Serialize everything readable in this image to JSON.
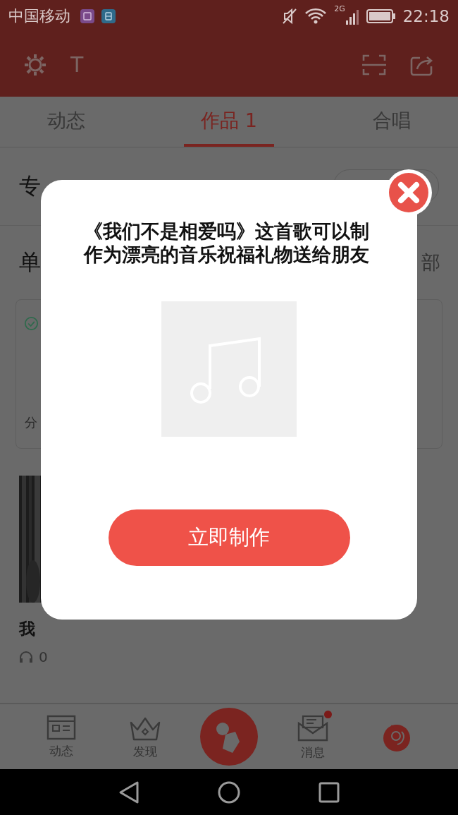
{
  "status_bar": {
    "carrier": "中国移动",
    "network": "2G",
    "time": "22:18"
  },
  "header": {
    "font_button": "T"
  },
  "tabs": [
    {
      "label": "动态",
      "selected": false
    },
    {
      "label": "作品 1",
      "selected": true
    },
    {
      "label": "合唱",
      "selected": false
    }
  ],
  "background": {
    "album_heading": "专",
    "singles_heading": "单",
    "view_all": "部",
    "card_text": "分",
    "song_title": "我",
    "play_count": "0"
  },
  "dialog": {
    "message": "《我们不是相爱吗》这首歌可以制作为漂亮的音乐祝福礼物送给朋友",
    "button": "立即制作"
  },
  "bottom_nav": [
    {
      "label": "动态",
      "kind": "feed",
      "badge": false
    },
    {
      "label": "发现",
      "kind": "discover",
      "badge": false
    },
    {
      "kind": "record",
      "badge": false
    },
    {
      "label": "消息",
      "kind": "messages",
      "badge": true
    },
    {
      "kind": "profile",
      "badge": false
    }
  ]
}
